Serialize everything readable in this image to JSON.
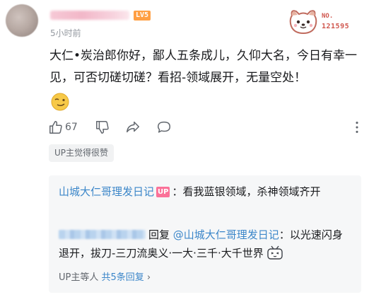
{
  "comment": {
    "level_badge": "LV5",
    "timestamp": "5小时前",
    "text": "大仁•炭治郎你好，鄙人五条成儿，久仰大名，今日有幸一见，可否切磋切磋？看招-领域展开，无量空处！",
    "like_count": "67",
    "up_liked_label": "UP主觉得很赞"
  },
  "fan_badge": {
    "no_label": "NO.",
    "number": "121595"
  },
  "replies": [
    {
      "author": "山城大仁哥理发日记",
      "up_tag": "UP",
      "text": "：看我蓝银领域，杀神领域齐开"
    },
    {
      "reply_word": "回复",
      "mention": "@山城大仁哥理发日记",
      "text": "：以光速闪身退开，拔刀-三刀流奥义·一大·三千·大千世界"
    }
  ],
  "reply_summary": {
    "prefix": "UP主等人",
    "link": "共5条回复",
    "arrow": "›"
  },
  "icons": {
    "like": "thumbs-up-icon",
    "dislike": "thumbs-down-icon",
    "share": "share-icon",
    "reply": "comment-bubble-icon",
    "more": "more-vertical-icon"
  },
  "colors": {
    "link": "#3b86c9",
    "up_tag": "#fb7299",
    "level_badge": "#ff9f43",
    "fan_number": "#d0574e"
  }
}
